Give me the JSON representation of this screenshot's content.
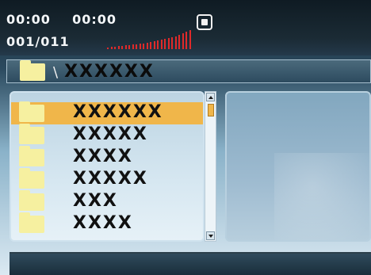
{
  "status": {
    "time_elapsed": "00:00",
    "time_total": "00:00",
    "track_counter": "001/011",
    "level_bars": [
      2,
      3,
      3,
      4,
      4,
      5,
      5,
      6,
      6,
      7,
      7,
      8,
      9,
      10,
      11,
      12,
      13,
      14,
      15,
      16,
      18,
      20,
      22,
      24
    ]
  },
  "path": {
    "separator": "\\",
    "current": "XXXXXX"
  },
  "files": [
    {
      "name": "XXXXXX",
      "selected": true
    },
    {
      "name": "XXXXX",
      "selected": false
    },
    {
      "name": "XXXX",
      "selected": false
    },
    {
      "name": "XXXXX",
      "selected": false
    },
    {
      "name": "XXX",
      "selected": false
    },
    {
      "name": "XXXX",
      "selected": false
    }
  ],
  "colors": {
    "selection": "#f0b64a",
    "level": "#e02a2a",
    "folder": "#f6f0a0"
  },
  "icons": {
    "stop": "stop-icon",
    "folder": "folder-icon",
    "scroll_up": "scroll-up-arrow-icon",
    "scroll_down": "scroll-down-arrow-icon"
  }
}
